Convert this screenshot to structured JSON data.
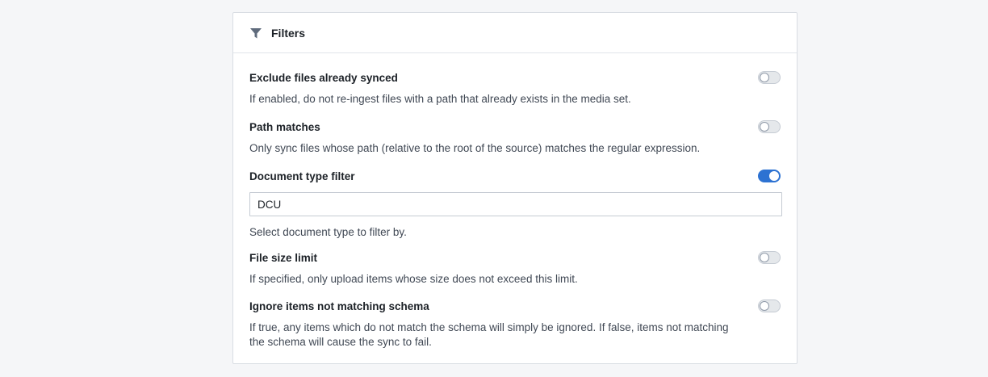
{
  "panel": {
    "title": "Filters",
    "icon": "filter-icon"
  },
  "filters": [
    {
      "label": "Exclude files already synced",
      "description": "If enabled, do not re-ingest files with a path that already exists in the media set.",
      "enabled": false
    },
    {
      "label": "Path matches",
      "description": "Only sync files whose path (relative to the root of the source) matches the regular expression.",
      "enabled": false
    },
    {
      "label": "Document type filter",
      "input_value": "DCU",
      "description": "Select document type to filter by.",
      "enabled": true
    },
    {
      "label": "File size limit",
      "description": "If specified, only upload items whose size does not exceed this limit.",
      "enabled": false
    },
    {
      "label": "Ignore items not matching schema",
      "description": "If true, any items which do not match the schema will simply be ignored. If false, items not matching the schema will cause the sync to fail.",
      "enabled": false
    }
  ],
  "colors": {
    "accent": "#2d72d2",
    "background": "#f5f6f8"
  }
}
